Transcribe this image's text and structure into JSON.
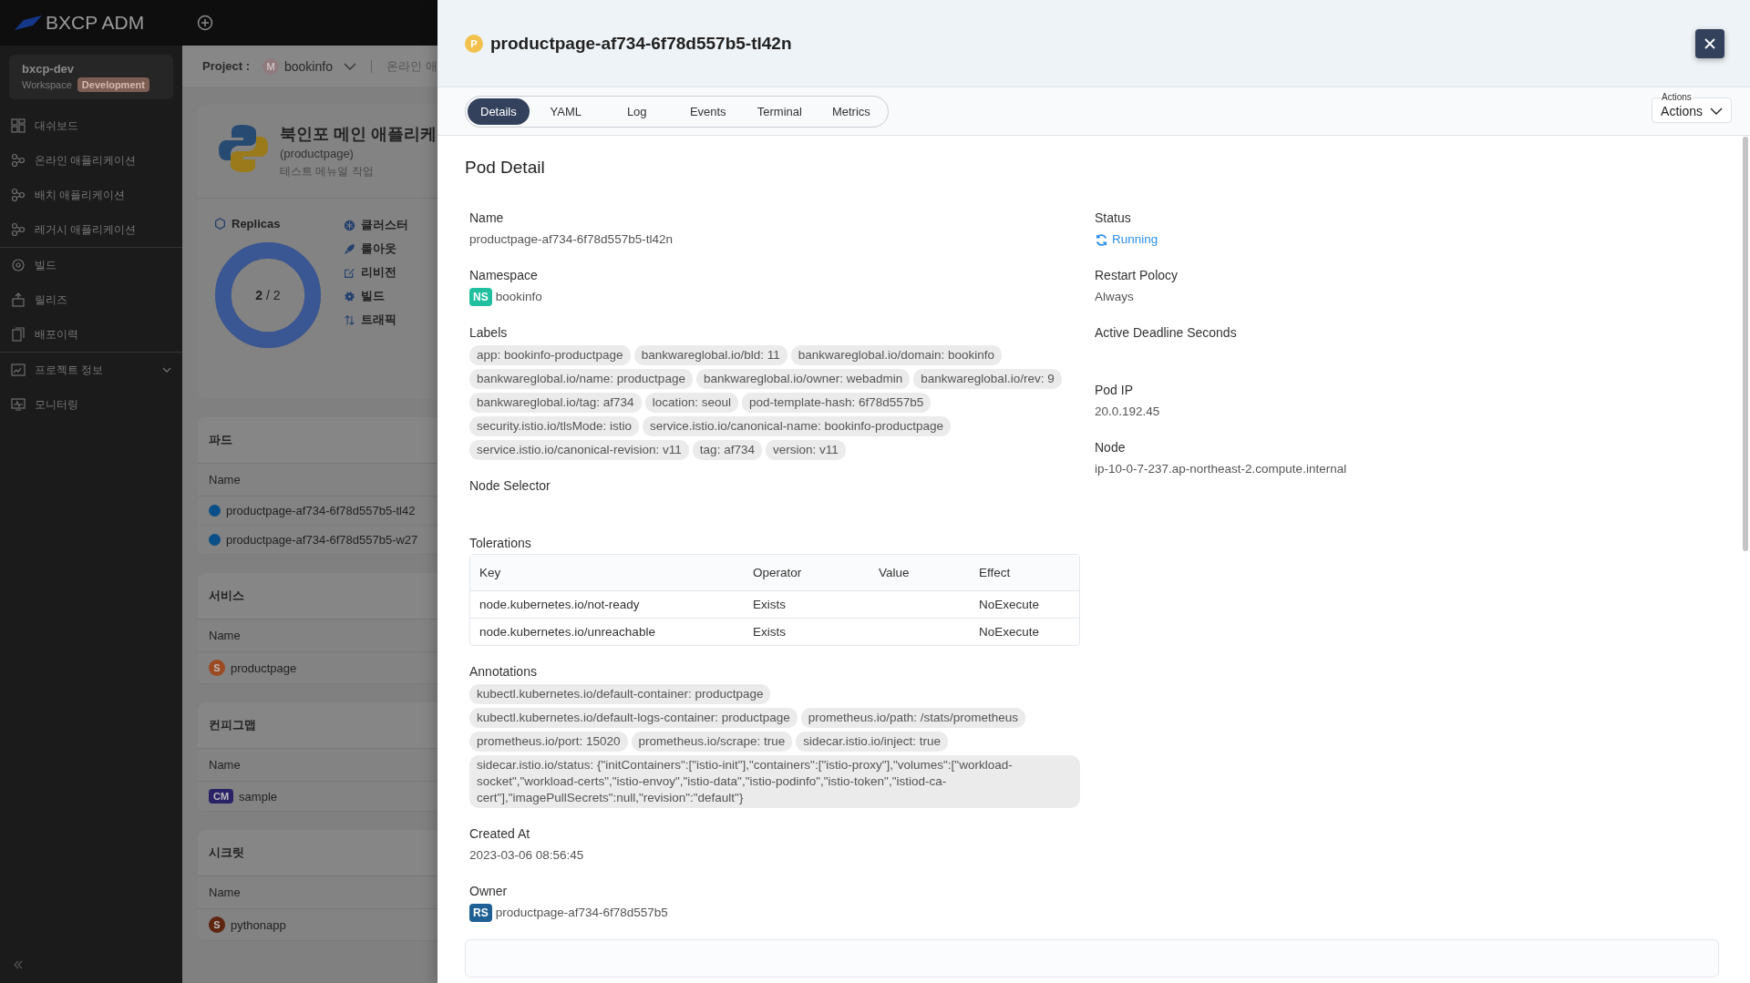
{
  "app": {
    "logo": "BXCP ADM"
  },
  "workspace": {
    "name": "bxcp-dev",
    "label": "Workspace",
    "badge": "Development"
  },
  "nav_groups": [
    [
      {
        "label": "대쉬보드",
        "expandable": false
      },
      {
        "label": "온라인 애플리케이션",
        "expandable": false
      },
      {
        "label": "배치 애플리케이션",
        "expandable": false
      },
      {
        "label": "레거시 애플리케이션",
        "expandable": false
      }
    ],
    [
      {
        "label": "빌드",
        "expandable": false
      },
      {
        "label": "릴리즈",
        "expandable": false
      },
      {
        "label": "배포이력",
        "expandable": false
      }
    ],
    [
      {
        "label": "프로젝트 정보",
        "expandable": true
      },
      {
        "label": "모니터링",
        "expandable": false
      }
    ]
  ],
  "project_bar": {
    "label": "Project :",
    "avatar": "M",
    "project": "bookinfo",
    "breadcrumb": "온라인 애"
  },
  "app_card": {
    "title": "북인포 메인 애플리케",
    "subtitle": "(productpage)",
    "description": "테스트 메뉴얼 작업",
    "replicas": {
      "label": "Replicas",
      "count": "**2** / 2",
      "level": 1
    },
    "facts": [
      "클러스터",
      "롤아웃",
      "리비전",
      "빌드",
      "트래픽"
    ]
  },
  "sections": [
    {
      "title": "파드",
      "column": "Name",
      "rows": [
        {
          "kind": "dot",
          "color": "#0b4f88",
          "text": "productpage-af734-6f78d557b5-tl42"
        },
        {
          "kind": "dot",
          "color": "#0b4f88",
          "text": "productpage-af734-6f78d557b5-w27"
        }
      ]
    },
    {
      "title": "서비스",
      "column": "Name",
      "rows": [
        {
          "kind": "badge",
          "badge": "S",
          "color": "#9c4a22",
          "text": "productpage"
        }
      ]
    },
    {
      "title": "컨피그맵",
      "column": "Name",
      "rows": [
        {
          "kind": "badge",
          "badge": "CM",
          "color": "#2a2266",
          "text": "sample"
        }
      ]
    },
    {
      "title": "시크릿",
      "column": "Name",
      "rows": [
        {
          "kind": "badge",
          "badge": "S",
          "color": "#5e2610",
          "text": "pythonapp"
        }
      ]
    }
  ],
  "drawer": {
    "badge": "P",
    "title": "productpage-af734-6f78d557b5-tl42n",
    "tabs": [
      {
        "label": "Details",
        "selected": true
      },
      {
        "label": "YAML",
        "selected": false
      },
      {
        "label": "Log",
        "selected": false
      },
      {
        "label": "Events",
        "selected": false
      },
      {
        "label": "Terminal",
        "selected": false
      },
      {
        "label": "Metrics",
        "selected": false
      }
    ],
    "actions": {
      "label": "Actions",
      "value": "Actions"
    },
    "heading": "Pod Detail",
    "left": [
      {
        "kind": "text",
        "label": "Name",
        "value": "productpage-af734-6f78d557b5-tl42n"
      },
      {
        "kind": "tag",
        "label": "Namespace",
        "badge": "NS",
        "color": "#1fbf9f",
        "value": "bookinfo"
      },
      {
        "kind": "chips",
        "label": "Labels",
        "items": [
          "app: bookinfo-productpage",
          "bankwareglobal.io/bld: 11",
          "bankwareglobal.io/domain: bookinfo",
          "bankwareglobal.io/name: productpage",
          "bankwareglobal.io/owner: webadmin",
          "bankwareglobal.io/rev: 9",
          "bankwareglobal.io/tag: af734",
          "location: seoul",
          "pod-template-hash: 6f78d557b5",
          "security.istio.io/tlsMode: istio",
          "service.istio.io/canonical-name: bookinfo-productpage",
          "service.istio.io/canonical-revision: v11",
          "tag: af734",
          "version: v11"
        ]
      },
      {
        "kind": "empty",
        "label": "Node Selector"
      },
      {
        "kind": "table",
        "label": "Tolerations",
        "columns": [
          "Key",
          "Operator",
          "Value",
          "Effect"
        ],
        "rows": [
          [
            "node.kubernetes.io/not-ready",
            "Exists",
            "",
            "NoExecute"
          ],
          [
            "node.kubernetes.io/unreachable",
            "Exists",
            "",
            "NoExecute"
          ]
        ]
      },
      {
        "kind": "chips",
        "label": "Annotations",
        "items": [
          "kubectl.kubernetes.io/default-container: productpage",
          "kubectl.kubernetes.io/default-logs-container: productpage",
          "prometheus.io/path: /stats/prometheus",
          "prometheus.io/port: 15020",
          "prometheus.io/scrape: true",
          "sidecar.istio.io/inject: true",
          "sidecar.istio.io/status: {\"initContainers\":[\"istio-init\"],\"containers\":[\"istio-proxy\"],\"volumes\":[\"workload-socket\",\"workload-certs\",\"istio-envoy\",\"istio-data\",\"istio-podinfo\",\"istio-token\",\"istiod-ca-cert\"],\"imagePullSecrets\":null,\"revision\":\"default\"}"
        ]
      },
      {
        "kind": "text",
        "label": "Created At",
        "value": "2023-03-06 08:56:45"
      },
      {
        "kind": "tag",
        "label": "Owner",
        "badge": "RS",
        "color": "#1e5f94",
        "value": "productpage-af734-6f78d557b5"
      }
    ],
    "right": [
      {
        "kind": "status",
        "label": "Status",
        "value": "Running"
      },
      {
        "kind": "text",
        "label": "Restart Polocy",
        "value": "Always"
      },
      {
        "kind": "empty",
        "label": "Active Deadline Seconds"
      },
      {
        "kind": "text",
        "label": "Pod IP",
        "value": "20.0.192.45"
      },
      {
        "kind": "text",
        "label": "Node",
        "value": "ip-10-0-7-237.ap-northeast-2.compute.internal"
      }
    ]
  }
}
